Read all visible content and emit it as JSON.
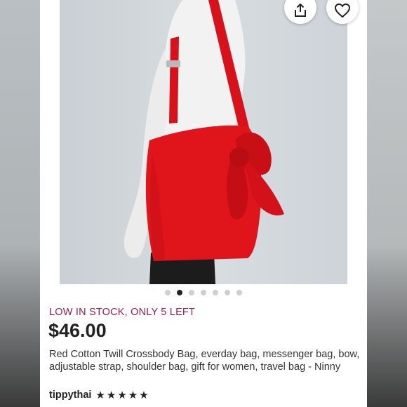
{
  "listing": {
    "stock_status": "LOW IN STOCK, ONLY 5 LEFT",
    "price": "$46.00",
    "title": "Red Cotton Twill Crossbody Bag, everday bag, messenger bag, bow, adjustable strap, shoulder bag, gift for women, travel bag - Ninny",
    "seller": "tippythai",
    "rating": 5,
    "rating_max": 5,
    "image_count": 7,
    "active_image": 2
  },
  "actions": {
    "share_icon": "share-icon",
    "favorite_icon": "heart-icon"
  },
  "colors": {
    "stock_text": "#9b1d4a",
    "bag": "#e0141b",
    "active_dot": "#222222",
    "inactive_dot": "#cfcfcf"
  }
}
